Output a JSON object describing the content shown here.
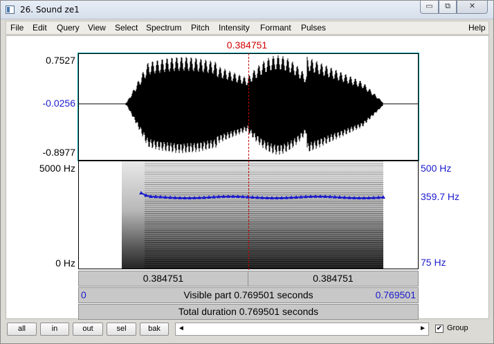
{
  "window": {
    "title": "26. Sound ze1",
    "controls": {
      "minimize": "▭",
      "maximize": "⧉",
      "close": "✕"
    }
  },
  "menu": {
    "items": [
      "File",
      "Edit",
      "Query",
      "View",
      "Select",
      "Spectrum",
      "Pitch",
      "Intensity",
      "Formant",
      "Pulses"
    ],
    "help": "Help"
  },
  "cursor": {
    "time_label": "0.384751"
  },
  "waveform": {
    "y_max": "0.7527",
    "y_cursor": "-0.0256",
    "y_min": "-0.8977"
  },
  "spectrogram": {
    "freq_top": "5000 Hz",
    "freq_bottom": "0 Hz",
    "pitch_top": "500 Hz",
    "pitch_current": "359.7 Hz",
    "pitch_bottom": "75 Hz"
  },
  "bars": {
    "left_segment": "0.384751",
    "right_segment": "0.384751",
    "visible_start": "0",
    "visible_text": "Visible part 0.769501 seconds",
    "visible_end": "0.769501",
    "total_text": "Total duration 0.769501 seconds"
  },
  "buttons": {
    "all": "all",
    "in": "in",
    "out": "out",
    "sel": "sel",
    "bak": "bak"
  },
  "scrollbar": {
    "left_arrow": "◄",
    "right_arrow": "►"
  },
  "group": {
    "checked": true,
    "label": "Group",
    "check_mark": "✔"
  }
}
